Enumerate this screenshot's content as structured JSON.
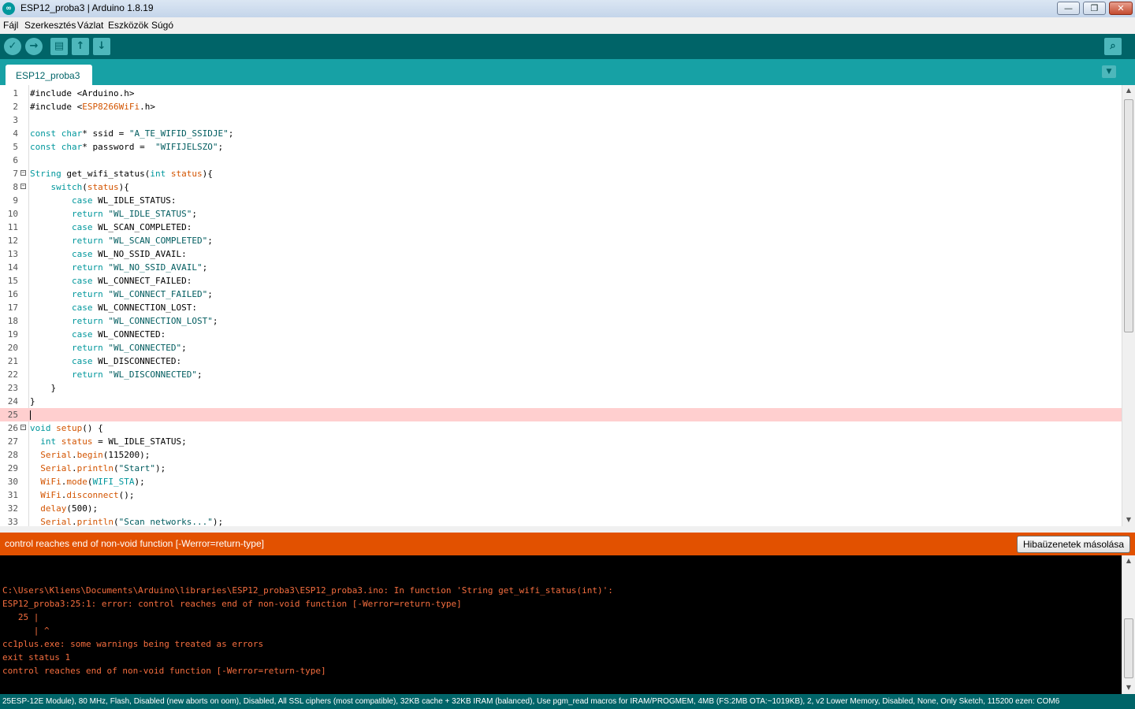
{
  "window": {
    "title": "ESP12_proba3 | Arduino 1.8.19",
    "minimize_glyph": "—",
    "maximize_glyph": "❐",
    "close_glyph": "✕"
  },
  "menu": [
    "Fájl",
    "Szerkesztés",
    "Vázlat",
    "Eszközök",
    "Súgó"
  ],
  "toolbar": {
    "icons": [
      "verify-icon",
      "upload-icon",
      "new-icon",
      "open-icon",
      "save-icon",
      "serial-monitor-icon"
    ],
    "accent": "#006468"
  },
  "tab": {
    "label": "ESP12_proba3"
  },
  "editor": {
    "line_numbers": [
      "1",
      "2",
      "3",
      "4",
      "5",
      "6",
      "7",
      "8",
      "9",
      "10",
      "11",
      "12",
      "13",
      "14",
      "15",
      "16",
      "17",
      "18",
      "19",
      "20",
      "21",
      "22",
      "23",
      "24",
      "25",
      "26",
      "27",
      "28",
      "29",
      "30",
      "31",
      "32",
      "33"
    ],
    "highlight_line": 25,
    "lines": [
      "#include <Arduino.h>",
      "#include <ESP8266WiFi.h>",
      "",
      "const char* ssid = \"A_TE_WIFID_SSIDJE\";",
      "const char* password =  \"WIFIJELSZO\";",
      "",
      "String get_wifi_status(int status){",
      "    switch(status){",
      "        case WL_IDLE_STATUS:",
      "        return \"WL_IDLE_STATUS\";",
      "        case WL_SCAN_COMPLETED:",
      "        return \"WL_SCAN_COMPLETED\";",
      "        case WL_NO_SSID_AVAIL:",
      "        return \"WL_NO_SSID_AVAIL\";",
      "        case WL_CONNECT_FAILED:",
      "        return \"WL_CONNECT_FAILED\";",
      "        case WL_CONNECTION_LOST:",
      "        return \"WL_CONNECTION_LOST\";",
      "        case WL_CONNECTED:",
      "        return \"WL_CONNECTED\";",
      "        case WL_DISCONNECTED:",
      "        return \"WL_DISCONNECTED\";",
      "    }",
      "}",
      "",
      "void setup() {",
      "  int status = WL_IDLE_STATUS;",
      "  Serial.begin(115200);",
      "  Serial.println(\"Start\");",
      "  WiFi.mode(WIFI_STA);",
      "  WiFi.disconnect();",
      "  delay(500);",
      "  Serial.println(\"Scan networks...\");"
    ]
  },
  "error_bar": {
    "message": "control reaches end of non-void function [-Werror=return-type]",
    "copy_button": "Hibaüzenetek másolása",
    "color": "#e25100"
  },
  "console": {
    "lines": [
      "C:\\Users\\Kliens\\Documents\\Arduino\\libraries\\ESP12_proba3\\ESP12_proba3.ino: In function 'String get_wifi_status(int)':",
      "ESP12_proba3:25:1: error: control reaches end of non-void function [-Werror=return-type]",
      "   25 |",
      "      | ^",
      "cc1plus.exe: some warnings being treated as errors",
      "exit status 1",
      "control reaches end of non-void function [-Werror=return-type]"
    ],
    "text_color": "#f56e3f"
  },
  "status_bar": {
    "line_indicator": "25",
    "text": "ESP-12E Module), 80 MHz, Flash, Disabled (new aborts on oom), Disabled, All SSL ciphers (most compatible), 32KB cache + 32KB IRAM (balanced), Use pgm_read macros for IRAM/PROGMEM, 4MB (FS:2MB OTA:~1019KB), 2, v2 Lower Memory, Disabled, None, Only Sketch, 115200 ezen: COM6"
  }
}
